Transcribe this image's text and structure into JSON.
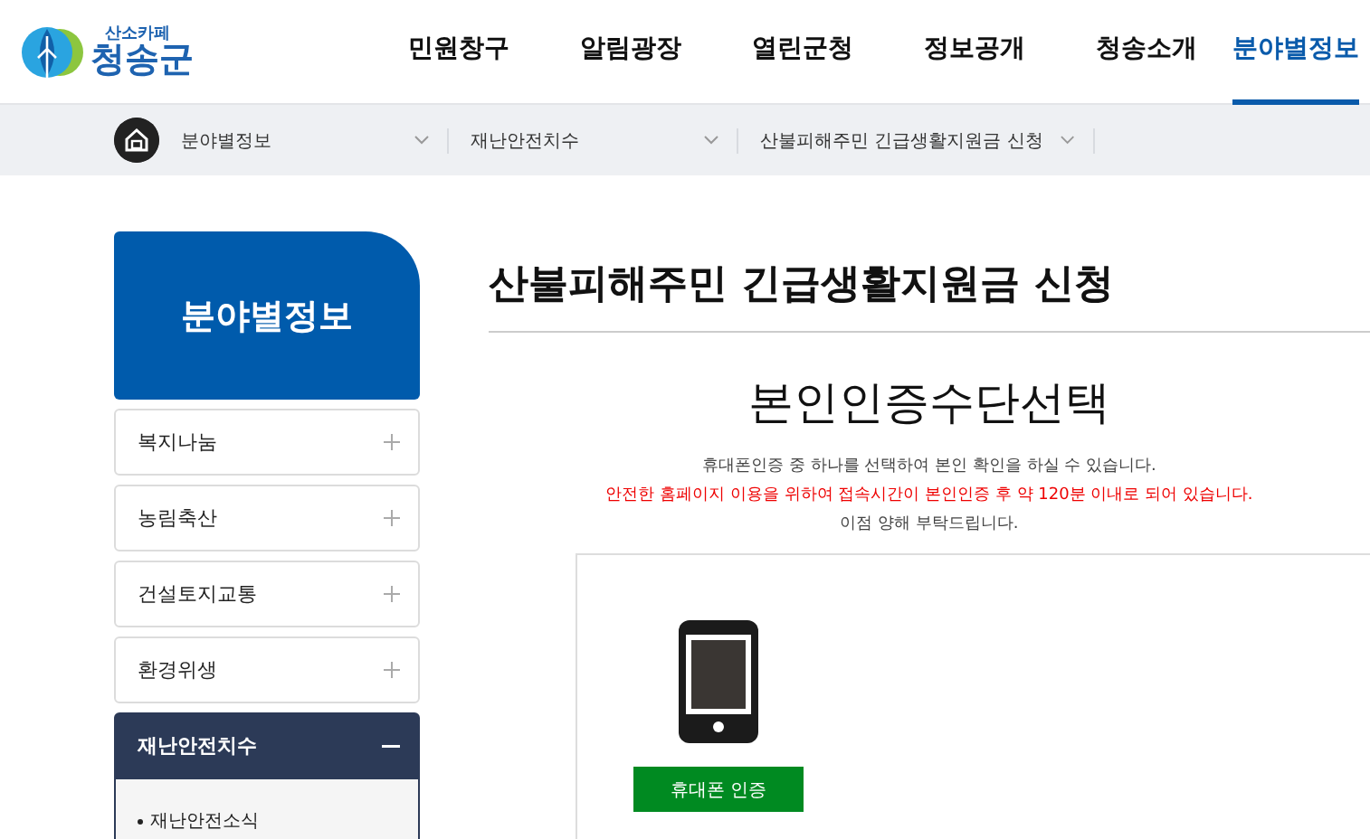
{
  "logo": {
    "tagline": "산소카페",
    "name": "청송군"
  },
  "nav": [
    {
      "label": "민원창구",
      "selected": false
    },
    {
      "label": "알림광장",
      "selected": false
    },
    {
      "label": "열린군청",
      "selected": false
    },
    {
      "label": "정보공개",
      "selected": false
    },
    {
      "label": "청송소개",
      "selected": false
    },
    {
      "label": "분야별정보",
      "selected": true
    }
  ],
  "breadcrumb": [
    {
      "label": "분야별정보"
    },
    {
      "label": "재난안전치수"
    },
    {
      "label": "산불피해주민 긴급생활지원금 신청"
    }
  ],
  "sidebar": {
    "title": "분야별정보",
    "items": [
      {
        "label": "복지나눔",
        "expanded": false
      },
      {
        "label": "농림축산",
        "expanded": false
      },
      {
        "label": "건설토지교통",
        "expanded": false
      },
      {
        "label": "환경위생",
        "expanded": false
      },
      {
        "label": "재난안전치수",
        "expanded": true,
        "children": [
          {
            "label": "재난안전소식"
          }
        ]
      }
    ]
  },
  "page_title": "산불피해주민 긴급생활지원금 신청",
  "section_title": "본인인증수단선택",
  "notice": [
    {
      "kind": "normal",
      "text": "휴대폰인증 중 하나를 선택하여 본인 확인을 하실 수 있습니다."
    },
    {
      "kind": "warning",
      "text": "안전한 홈페이지 이용을 위하여 접속시간이 본인인증 후 약 120분 이내로 되어 있습니다."
    },
    {
      "kind": "normal",
      "text": "이점 양해 부탁드립니다."
    }
  ],
  "auth_button": "휴대폰 인증"
}
